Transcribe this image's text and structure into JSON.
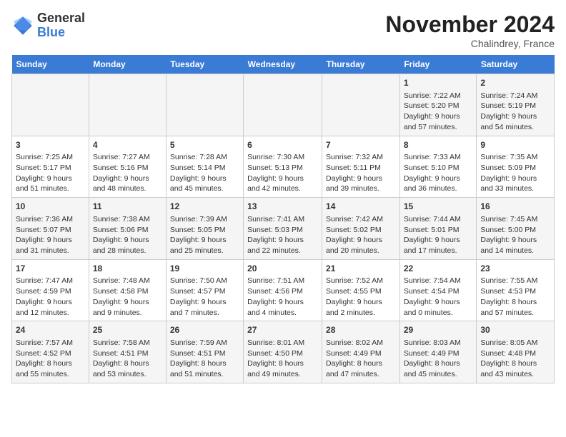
{
  "header": {
    "logo_general": "General",
    "logo_blue": "Blue",
    "month_title": "November 2024",
    "location": "Chalindrey, France"
  },
  "days_of_week": [
    "Sunday",
    "Monday",
    "Tuesday",
    "Wednesday",
    "Thursday",
    "Friday",
    "Saturday"
  ],
  "weeks": [
    [
      {
        "day": "",
        "info": ""
      },
      {
        "day": "",
        "info": ""
      },
      {
        "day": "",
        "info": ""
      },
      {
        "day": "",
        "info": ""
      },
      {
        "day": "",
        "info": ""
      },
      {
        "day": "1",
        "info": "Sunrise: 7:22 AM\nSunset: 5:20 PM\nDaylight: 9 hours and 57 minutes."
      },
      {
        "day": "2",
        "info": "Sunrise: 7:24 AM\nSunset: 5:19 PM\nDaylight: 9 hours and 54 minutes."
      }
    ],
    [
      {
        "day": "3",
        "info": "Sunrise: 7:25 AM\nSunset: 5:17 PM\nDaylight: 9 hours and 51 minutes."
      },
      {
        "day": "4",
        "info": "Sunrise: 7:27 AM\nSunset: 5:16 PM\nDaylight: 9 hours and 48 minutes."
      },
      {
        "day": "5",
        "info": "Sunrise: 7:28 AM\nSunset: 5:14 PM\nDaylight: 9 hours and 45 minutes."
      },
      {
        "day": "6",
        "info": "Sunrise: 7:30 AM\nSunset: 5:13 PM\nDaylight: 9 hours and 42 minutes."
      },
      {
        "day": "7",
        "info": "Sunrise: 7:32 AM\nSunset: 5:11 PM\nDaylight: 9 hours and 39 minutes."
      },
      {
        "day": "8",
        "info": "Sunrise: 7:33 AM\nSunset: 5:10 PM\nDaylight: 9 hours and 36 minutes."
      },
      {
        "day": "9",
        "info": "Sunrise: 7:35 AM\nSunset: 5:09 PM\nDaylight: 9 hours and 33 minutes."
      }
    ],
    [
      {
        "day": "10",
        "info": "Sunrise: 7:36 AM\nSunset: 5:07 PM\nDaylight: 9 hours and 31 minutes."
      },
      {
        "day": "11",
        "info": "Sunrise: 7:38 AM\nSunset: 5:06 PM\nDaylight: 9 hours and 28 minutes."
      },
      {
        "day": "12",
        "info": "Sunrise: 7:39 AM\nSunset: 5:05 PM\nDaylight: 9 hours and 25 minutes."
      },
      {
        "day": "13",
        "info": "Sunrise: 7:41 AM\nSunset: 5:03 PM\nDaylight: 9 hours and 22 minutes."
      },
      {
        "day": "14",
        "info": "Sunrise: 7:42 AM\nSunset: 5:02 PM\nDaylight: 9 hours and 20 minutes."
      },
      {
        "day": "15",
        "info": "Sunrise: 7:44 AM\nSunset: 5:01 PM\nDaylight: 9 hours and 17 minutes."
      },
      {
        "day": "16",
        "info": "Sunrise: 7:45 AM\nSunset: 5:00 PM\nDaylight: 9 hours and 14 minutes."
      }
    ],
    [
      {
        "day": "17",
        "info": "Sunrise: 7:47 AM\nSunset: 4:59 PM\nDaylight: 9 hours and 12 minutes."
      },
      {
        "day": "18",
        "info": "Sunrise: 7:48 AM\nSunset: 4:58 PM\nDaylight: 9 hours and 9 minutes."
      },
      {
        "day": "19",
        "info": "Sunrise: 7:50 AM\nSunset: 4:57 PM\nDaylight: 9 hours and 7 minutes."
      },
      {
        "day": "20",
        "info": "Sunrise: 7:51 AM\nSunset: 4:56 PM\nDaylight: 9 hours and 4 minutes."
      },
      {
        "day": "21",
        "info": "Sunrise: 7:52 AM\nSunset: 4:55 PM\nDaylight: 9 hours and 2 minutes."
      },
      {
        "day": "22",
        "info": "Sunrise: 7:54 AM\nSunset: 4:54 PM\nDaylight: 9 hours and 0 minutes."
      },
      {
        "day": "23",
        "info": "Sunrise: 7:55 AM\nSunset: 4:53 PM\nDaylight: 8 hours and 57 minutes."
      }
    ],
    [
      {
        "day": "24",
        "info": "Sunrise: 7:57 AM\nSunset: 4:52 PM\nDaylight: 8 hours and 55 minutes."
      },
      {
        "day": "25",
        "info": "Sunrise: 7:58 AM\nSunset: 4:51 PM\nDaylight: 8 hours and 53 minutes."
      },
      {
        "day": "26",
        "info": "Sunrise: 7:59 AM\nSunset: 4:51 PM\nDaylight: 8 hours and 51 minutes."
      },
      {
        "day": "27",
        "info": "Sunrise: 8:01 AM\nSunset: 4:50 PM\nDaylight: 8 hours and 49 minutes."
      },
      {
        "day": "28",
        "info": "Sunrise: 8:02 AM\nSunset: 4:49 PM\nDaylight: 8 hours and 47 minutes."
      },
      {
        "day": "29",
        "info": "Sunrise: 8:03 AM\nSunset: 4:49 PM\nDaylight: 8 hours and 45 minutes."
      },
      {
        "day": "30",
        "info": "Sunrise: 8:05 AM\nSunset: 4:48 PM\nDaylight: 8 hours and 43 minutes."
      }
    ]
  ]
}
